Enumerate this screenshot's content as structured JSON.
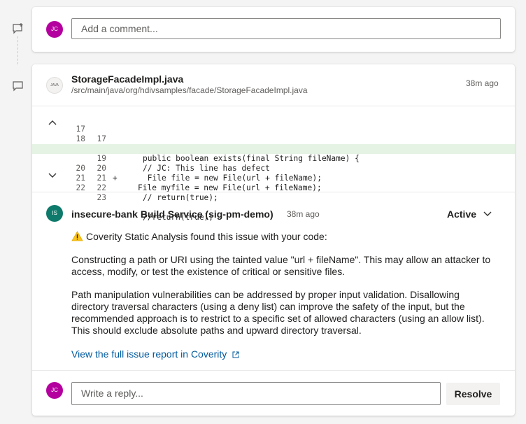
{
  "top_comment": {
    "avatar_initials": "JC",
    "placeholder": "Add a comment..."
  },
  "thread": {
    "file_name": "StorageFacadeImpl.java",
    "file_path": "/src/main/java/org/hdivsamples/facade/StorageFacadeImpl.java",
    "file_icon_label": "JAVA",
    "time": "38m ago",
    "icons": {
      "collapse": "chevron-up-icon",
      "expand": "chevron-down-icon",
      "comment": "comment-icon",
      "add_comment": "add-comment-icon"
    },
    "code_lines": [
      {
        "old": "17",
        "new": "17",
        "mark": "",
        "text": "public boolean exists(final String fileName) {",
        "added": false
      },
      {
        "old": "18",
        "new": "18",
        "mark": "",
        "text": "// JC: This line has defect",
        "added": false
      },
      {
        "old": "19",
        "new": "19",
        "mark": "",
        "text": " File file = new File(url + fileName);",
        "added": false
      },
      {
        "old": "",
        "new": "20",
        "mark": "+",
        "text": "File myfile = new File(url + fileName);",
        "added": true
      },
      {
        "old": "20",
        "new": "21",
        "mark": "",
        "text": "// return(true);",
        "added": false
      },
      {
        "old": "21",
        "new": "22",
        "mark": "",
        "text": "",
        "added": false
      },
      {
        "old": "22",
        "new": "23",
        "mark": "",
        "text": "//return(true);",
        "added": false
      }
    ],
    "comment": {
      "avatar_initials": "IS",
      "author": "insecure-bank Build Service (sig-pm-demo)",
      "time": "38m ago",
      "status": "Active",
      "intro": "Coverity Static Analysis found this issue with your code:",
      "paragraph1": "Constructing a path or URI using the tainted value \"url + fileName\". This may allow an attacker to access, modify, or test the existence of critical or sensitive files.",
      "paragraph2": "Path manipulation vulnerabilities can be addressed by proper input validation. Disallowing directory traversal characters (using a deny list) can improve the safety of the input, but the recommended approach is to restrict to a specific set of allowed characters (using an allow list). This should exclude absolute paths and upward directory traversal.",
      "link_text": "View the full issue report in Coverity",
      "warning_icon": "warning-icon",
      "external_icon": "external-link-icon",
      "colors": {
        "link": "#005a9e",
        "added_line": "#e4f3e3"
      }
    },
    "reply": {
      "avatar_initials": "JC",
      "placeholder": "Write a reply...",
      "resolve_label": "Resolve"
    }
  }
}
